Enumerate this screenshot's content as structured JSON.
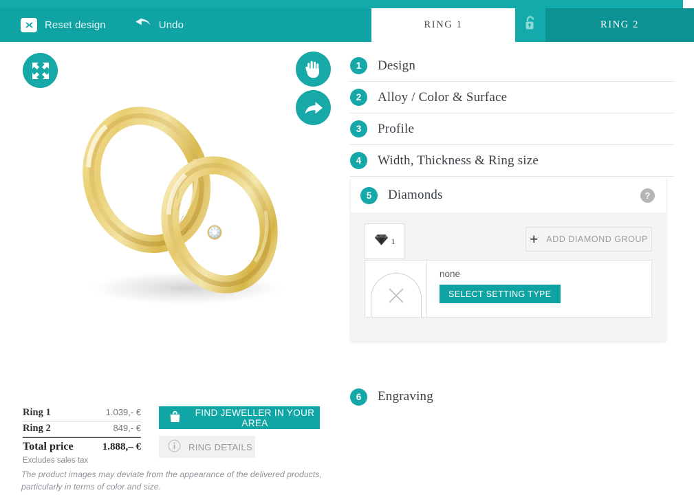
{
  "toolbar": {
    "reset_label": "Reset design",
    "reset_icon": "close-x-icon",
    "undo_label": "Undo",
    "undo_icon": "undo-arrow-icon"
  },
  "tabs": {
    "ring1": "RING 1",
    "lock_icon": "unlock-icon",
    "ring2": "RING 2"
  },
  "viewer": {
    "expand_icon": "fullscreen-expand-icon",
    "hand_icon": "hand-rotate-icon",
    "share_icon": "share-arrow-icon",
    "product_alt": "two gold wedding rings with diamond"
  },
  "prices": {
    "rows": [
      {
        "label": "Ring 1",
        "value": "1.039,- €"
      },
      {
        "label": "Ring 2",
        "value": "849,- €"
      }
    ],
    "total_label": "Total price",
    "total_value": "1.888,– €",
    "tax_note": "Excludes sales tax"
  },
  "actions": {
    "jeweller_label": "FIND JEWELLER IN YOUR AREA",
    "jeweller_icon": "shopping-bag-icon",
    "details_label": "RING DETAILS",
    "details_icon": "info-icon"
  },
  "disclaimer": "The product images may deviate from the appearance of the delivered products, particularly in terms of color and size.",
  "steps": [
    {
      "num": "1",
      "label": "Design"
    },
    {
      "num": "2",
      "label": "Alloy / Color & Surface"
    },
    {
      "num": "3",
      "label": "Profile"
    },
    {
      "num": "4",
      "label": "Width, Thickness & Ring size"
    }
  ],
  "diamonds": {
    "num": "5",
    "label": "Diamonds",
    "help_icon": "help-question-icon",
    "group_tab": {
      "icon": "diamond-icon",
      "count": "1"
    },
    "add_group_label": "ADD DIAMOND GROUP",
    "add_group_icon": "plus-icon",
    "setting": {
      "thumb_icon": "none-cross-icon",
      "status": "none",
      "button_label": "SELECT SETTING TYPE"
    }
  },
  "engraving": {
    "num": "6",
    "label": "Engraving"
  },
  "colors": {
    "accent": "#12AAAA",
    "accent_dark": "#0C9292",
    "panel_bg": "#F4F4F4",
    "text": "#3C4248"
  }
}
